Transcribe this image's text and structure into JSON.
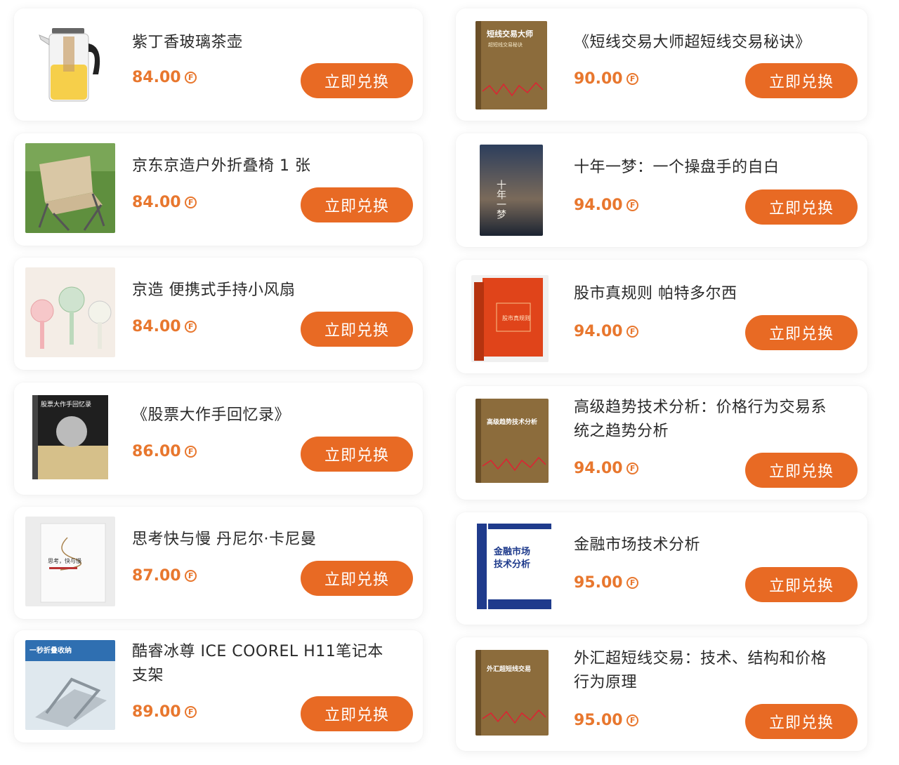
{
  "accent": "#e8772e",
  "button_color": "#e86a24",
  "coin_icon": "currency-coin-icon",
  "left": [
    {
      "title": "紫丁香玻璃茶壶",
      "price": "84.00",
      "button": "立即兑换",
      "image": "glass-teapot-image"
    },
    {
      "title": "京东京造户外折叠椅 1 张",
      "price": "84.00",
      "button": "立即兑换",
      "image": "folding-chair-image"
    },
    {
      "title": "京造 便携式手持小风扇",
      "price": "84.00",
      "button": "立即兑换",
      "image": "handheld-fans-image"
    },
    {
      "title": "《股票大作手回忆录》",
      "price": "86.00",
      "button": "立即兑换",
      "image": "book-cover-image"
    },
    {
      "title": "思考快与慢 丹尼尔·卡尼曼",
      "price": "87.00",
      "button": "立即兑换",
      "image": "book-cover-image"
    },
    {
      "title": "酷睿冰尊 ICE COOREL H11笔记本支架",
      "price": "89.00",
      "button": "立即兑换",
      "image": "laptop-stand-image"
    }
  ],
  "right": [
    {
      "title": "《短线交易大师超短线交易秘诀》",
      "price": "90.00",
      "button": "立即兑换",
      "image": "book-cover-image"
    },
    {
      "title": "十年一梦：一个操盘手的自白",
      "price": "94.00",
      "button": "立即兑换",
      "image": "book-cover-image"
    },
    {
      "title": "股市真规则 帕特多尔西",
      "price": "94.00",
      "button": "立即兑换",
      "image": "book-cover-image"
    },
    {
      "title": "高级趋势技术分析：价格行为交易系统之趋势分析",
      "price": "94.00",
      "button": "立即兑换",
      "image": "book-cover-image"
    },
    {
      "title": "金融市场技术分析",
      "price": "95.00",
      "button": "立即兑换",
      "image": "book-cover-image"
    },
    {
      "title": "外汇超短线交易：技术、结构和价格行为原理",
      "price": "95.00",
      "button": "立即兑换",
      "image": "book-cover-image"
    }
  ],
  "covers": {
    "short_term_master": {
      "line1": "短线交易大师",
      "line2": "超短线交易秘诀"
    },
    "ten_years": {
      "text": "十年一梦"
    },
    "stock_rules": {
      "text": "股市真规则"
    },
    "trend_analysis": {
      "text": "高级趋势技术分析"
    },
    "market_ta": {
      "line1": "金融市场",
      "line2": "技术分析"
    },
    "forex": {
      "text": "外汇超短线交易"
    },
    "reminiscences": {
      "text": "股票大作手回忆录"
    },
    "thinking": {
      "text": "思考，快与慢"
    },
    "stand_banner": {
      "text": "一秒折叠收纳"
    }
  }
}
